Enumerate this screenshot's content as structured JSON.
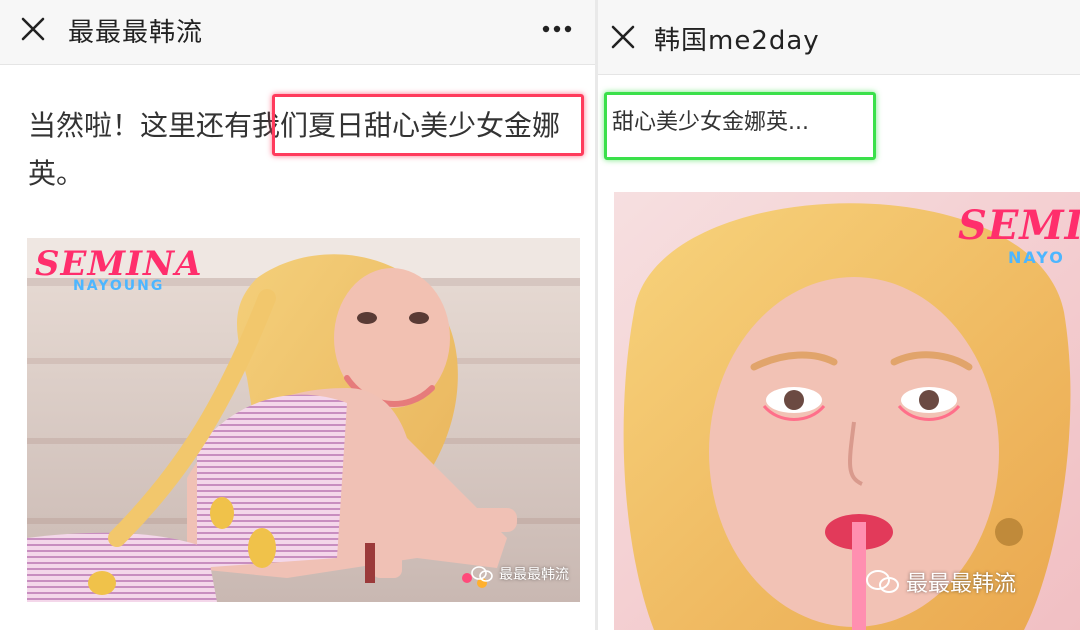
{
  "left": {
    "title": "最最最韩流",
    "article_text": "当然啦！这里还有我们夏日甜心美少女金娜英。",
    "photo": {
      "brand": "SEMINA",
      "brand_sub": "NAYOUNG",
      "watermark": "最最最韩流"
    }
  },
  "right": {
    "title": "韩国me2day",
    "snippet": "甜心美少女金娜英...",
    "photo": {
      "brand": "SEMIN",
      "brand_sub": "NAYO",
      "watermark": "最最最韩流"
    }
  },
  "colors": {
    "highlight_red": "#ff3b5c",
    "highlight_green": "#3ae04a"
  },
  "icons": [
    "close-icon",
    "more-icon",
    "wechat-icon"
  ]
}
